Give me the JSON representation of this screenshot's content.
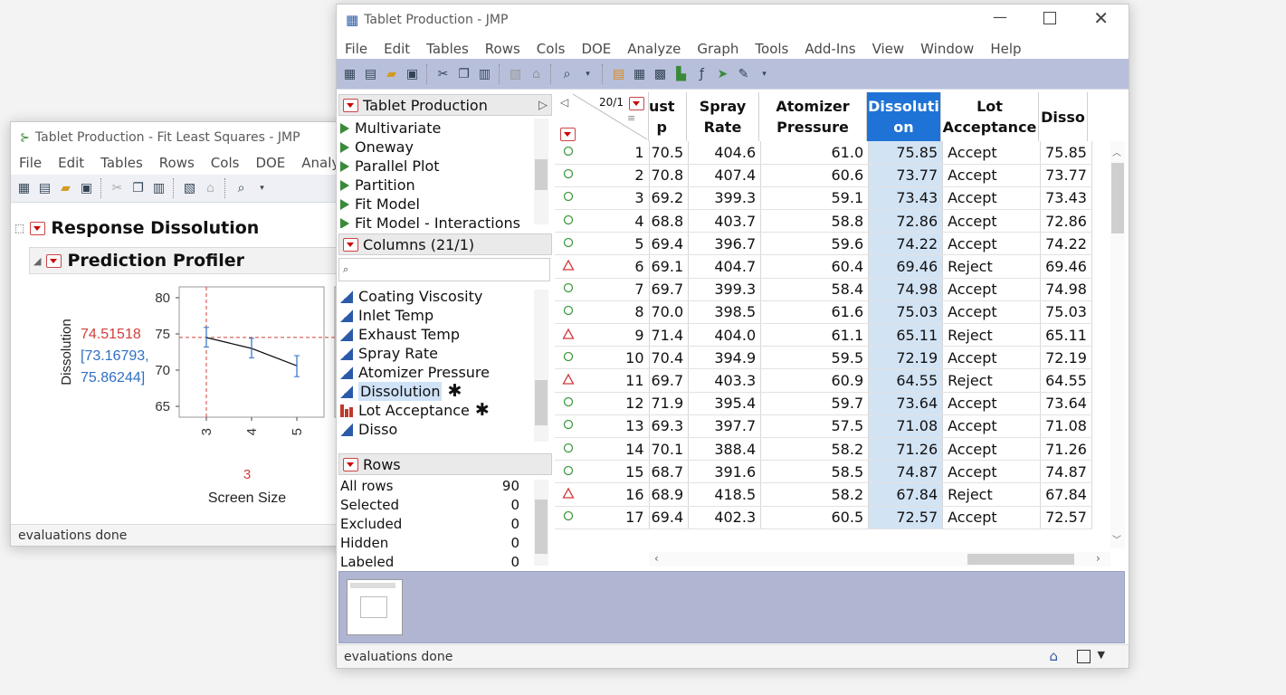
{
  "back": {
    "title": "Tablet Production - Fit Least Squares - JMP",
    "menu": [
      "File",
      "Edit",
      "Tables",
      "Rows",
      "Cols",
      "DOE",
      "Analyze"
    ],
    "report_title": "Response Dissolution",
    "outline": "Prediction Profiler",
    "profiler": {
      "ylabel": "Dissolution",
      "value": "74.51518",
      "ci_low": "[73.16793,",
      "ci_high": "75.86244]",
      "yticks": [
        "80",
        "75",
        "70",
        "65"
      ],
      "xticks": [
        "3",
        "4",
        "5"
      ],
      "x_current": "3",
      "xlabel": "Screen Size",
      "points": [
        {
          "x": 3,
          "y": 74.5,
          "lo": 73.2,
          "hi": 75.9
        },
        {
          "x": 4,
          "y": 73.0,
          "lo": 71.7,
          "hi": 74.4
        },
        {
          "x": 5,
          "y": 70.6,
          "lo": 69.1,
          "hi": 72.0
        }
      ],
      "ylim": [
        63.5,
        81.5
      ]
    },
    "status": "evaluations done"
  },
  "front": {
    "title": "Tablet Production - JMP",
    "menu": [
      "File",
      "Edit",
      "Tables",
      "Rows",
      "Cols",
      "DOE",
      "Analyze",
      "Graph",
      "Tools",
      "Add-Ins",
      "View",
      "Window",
      "Help"
    ],
    "table_name": "Tablet Production",
    "scripts": [
      "Multivariate",
      "Oneway",
      "Parallel Plot",
      "Partition",
      "Fit Model",
      "Fit Model - Interactions"
    ],
    "columns_header": "Columns (21/1)",
    "columns": [
      {
        "name": "Coating Viscosity",
        "type": "continuous"
      },
      {
        "name": "Inlet Temp",
        "type": "continuous"
      },
      {
        "name": "Exhaust Temp",
        "type": "continuous"
      },
      {
        "name": "Spray Rate",
        "type": "continuous"
      },
      {
        "name": "Atomizer Pressure",
        "type": "continuous"
      },
      {
        "name": "Dissolution",
        "type": "continuous",
        "selected": true,
        "mark": "✱"
      },
      {
        "name": "Lot Acceptance",
        "type": "nominal",
        "mark": "✱"
      },
      {
        "name": "Disso",
        "type": "continuous"
      }
    ],
    "rows_header": "Rows",
    "rows_summary": [
      {
        "label": "All rows",
        "value": "90"
      },
      {
        "label": "Selected",
        "value": "0"
      },
      {
        "label": "Excluded",
        "value": "0"
      },
      {
        "label": "Hidden",
        "value": "0"
      },
      {
        "label": "Labeled",
        "value": "0"
      }
    ],
    "corner_label": "20/1",
    "headers": [
      "ust\np",
      "Spray\nRate",
      "Atomizer\nPressure",
      "Dissoluti\non",
      "Lot\nAcceptance",
      "Disso"
    ],
    "rows": [
      {
        "n": "1",
        "m": "circle",
        "c": [
          "70.5",
          "404.6",
          "61.0",
          "75.85",
          "Accept",
          "75.85"
        ]
      },
      {
        "n": "2",
        "m": "circle",
        "c": [
          "70.8",
          "407.4",
          "60.6",
          "73.77",
          "Accept",
          "73.77"
        ]
      },
      {
        "n": "3",
        "m": "circle",
        "c": [
          "69.2",
          "399.3",
          "59.1",
          "73.43",
          "Accept",
          "73.43"
        ]
      },
      {
        "n": "4",
        "m": "circle",
        "c": [
          "68.8",
          "403.7",
          "58.8",
          "72.86",
          "Accept",
          "72.86"
        ]
      },
      {
        "n": "5",
        "m": "circle",
        "c": [
          "69.4",
          "396.7",
          "59.6",
          "74.22",
          "Accept",
          "74.22"
        ]
      },
      {
        "n": "6",
        "m": "triangle",
        "c": [
          "69.1",
          "404.7",
          "60.4",
          "69.46",
          "Reject",
          "69.46"
        ]
      },
      {
        "n": "7",
        "m": "circle",
        "c": [
          "69.7",
          "399.3",
          "58.4",
          "74.98",
          "Accept",
          "74.98"
        ]
      },
      {
        "n": "8",
        "m": "circle",
        "c": [
          "70.0",
          "398.5",
          "61.6",
          "75.03",
          "Accept",
          "75.03"
        ]
      },
      {
        "n": "9",
        "m": "triangle",
        "c": [
          "71.4",
          "404.0",
          "61.1",
          "65.11",
          "Reject",
          "65.11"
        ]
      },
      {
        "n": "10",
        "m": "circle",
        "c": [
          "70.4",
          "394.9",
          "59.5",
          "72.19",
          "Accept",
          "72.19"
        ]
      },
      {
        "n": "11",
        "m": "triangle",
        "c": [
          "69.7",
          "403.3",
          "60.9",
          "64.55",
          "Reject",
          "64.55"
        ]
      },
      {
        "n": "12",
        "m": "circle",
        "c": [
          "71.9",
          "395.4",
          "59.7",
          "73.64",
          "Accept",
          "73.64"
        ]
      },
      {
        "n": "13",
        "m": "circle",
        "c": [
          "69.3",
          "397.7",
          "57.5",
          "71.08",
          "Accept",
          "71.08"
        ]
      },
      {
        "n": "14",
        "m": "circle",
        "c": [
          "70.1",
          "388.4",
          "58.2",
          "71.26",
          "Accept",
          "71.26"
        ]
      },
      {
        "n": "15",
        "m": "circle",
        "c": [
          "68.7",
          "391.6",
          "58.5",
          "74.87",
          "Accept",
          "74.87"
        ]
      },
      {
        "n": "16",
        "m": "triangle",
        "c": [
          "68.9",
          "418.5",
          "58.2",
          "67.84",
          "Reject",
          "67.84"
        ]
      },
      {
        "n": "17",
        "m": "circle",
        "c": [
          "69.4",
          "402.3",
          "60.5",
          "72.57",
          "Accept",
          "72.57"
        ]
      }
    ],
    "status": "evaluations done",
    "colors": {
      "selected_col": "#1f73d6",
      "accept": "#3f9a3f",
      "reject": "#d13b3b"
    }
  }
}
